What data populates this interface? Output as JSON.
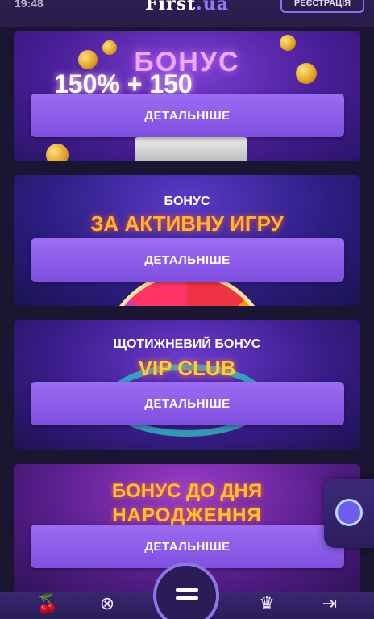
{
  "status": {
    "time": "19:48"
  },
  "header": {
    "logo_main": "First",
    "logo_tld": ".ua",
    "register_label": "РЕЄСТРАЦІЯ"
  },
  "cards": [
    {
      "heading": "БОНУС",
      "subheading": "150% + 150",
      "button": "ДЕТАЛЬНІШЕ"
    },
    {
      "heading": "БОНУС",
      "subheading": "ЗА АКТИВНУ ИГРУ",
      "button": "ДЕТАЛЬНІШЕ"
    },
    {
      "heading": "ЩОТИЖНЕВИЙ БОНУС",
      "subheading": "VIP CLUB",
      "button": "ДЕТАЛЬНІШЕ"
    },
    {
      "heading": "БОНУС ДО ДНЯ",
      "subheading": "НАРОДЖЕННЯ",
      "button": "ДЕТАЛЬНІШЕ"
    }
  ],
  "nav": {
    "icons": [
      "cherry-icon",
      "roulette-icon",
      "menu-icon",
      "crown-icon",
      "login-icon"
    ]
  },
  "colors": {
    "accent": "#8f6cf2",
    "button_top": "#9c6cf3",
    "button_bottom": "#7f4fe0"
  }
}
